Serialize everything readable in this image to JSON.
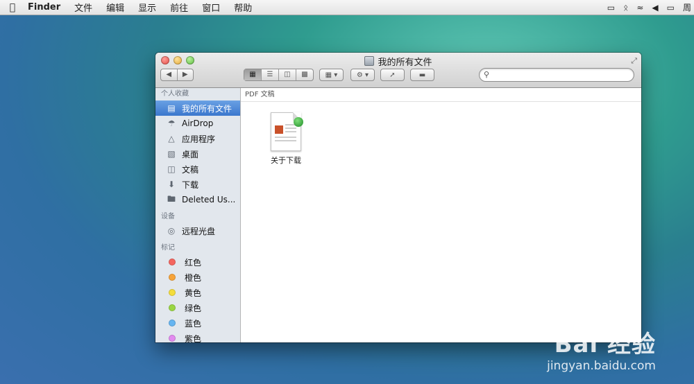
{
  "menubar": {
    "apple": "",
    "app": "Finder",
    "items": [
      "文件",
      "编辑",
      "显示",
      "前往",
      "窗口",
      "帮助"
    ],
    "status_tail": "周"
  },
  "window": {
    "title": "我的所有文件",
    "search_placeholder": ""
  },
  "sidebar": {
    "favorites_header": "个人收藏",
    "favorites": [
      {
        "label": "我的所有文件",
        "icon": "all-files-icon",
        "selected": true
      },
      {
        "label": "AirDrop",
        "icon": "airdrop-icon"
      },
      {
        "label": "应用程序",
        "icon": "applications-icon"
      },
      {
        "label": "桌面",
        "icon": "desktop-icon"
      },
      {
        "label": "文稿",
        "icon": "documents-icon"
      },
      {
        "label": "下载",
        "icon": "downloads-icon"
      },
      {
        "label": "Deleted Us...",
        "icon": "folder-icon"
      }
    ],
    "devices_header": "设备",
    "devices": [
      {
        "label": "远程光盘",
        "icon": "remote-disc-icon"
      }
    ],
    "tags_header": "标记",
    "tags": [
      {
        "label": "红色",
        "color": "#f4665f"
      },
      {
        "label": "橙色",
        "color": "#f7a43a"
      },
      {
        "label": "黄色",
        "color": "#f4dd3c"
      },
      {
        "label": "绿色",
        "color": "#9ad643"
      },
      {
        "label": "蓝色",
        "color": "#66b5f1"
      },
      {
        "label": "紫色",
        "color": "#e28bef"
      }
    ]
  },
  "content": {
    "group_header": "PDF 文稿",
    "files": [
      {
        "name": "关于下载",
        "icon": "pdf-document-icon"
      }
    ]
  },
  "watermark": {
    "brand": "Bai 经验",
    "url": "jingyan.baidu.com"
  }
}
